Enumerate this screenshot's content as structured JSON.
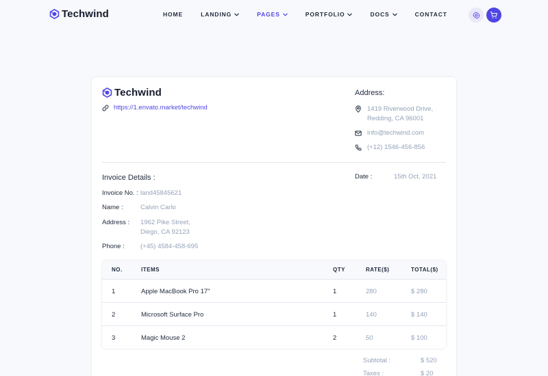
{
  "brand": {
    "name": "Techwind",
    "color": "#4f46e5"
  },
  "nav": {
    "items": [
      {
        "label": "HOME",
        "has_dropdown": false,
        "active": false
      },
      {
        "label": "LANDING",
        "has_dropdown": true,
        "active": false
      },
      {
        "label": "PAGES",
        "has_dropdown": true,
        "active": true
      },
      {
        "label": "PORTFOLIO",
        "has_dropdown": true,
        "active": false
      },
      {
        "label": "DOCS",
        "has_dropdown": true,
        "active": false
      },
      {
        "label": "CONTACT",
        "has_dropdown": false,
        "active": false
      }
    ],
    "icons": [
      "gear-icon",
      "cart-icon"
    ]
  },
  "invoice": {
    "company": "Techwind",
    "website": "https://1.envato.market/techwind",
    "address_title": "Address:",
    "address_line1": "1419 Riverwood Drive,",
    "address_line2": "Redding, CA 96001",
    "email": "info@techwind.com",
    "phone": "(+12) 1546-456-856",
    "details_title": "Invoice Details :",
    "date_label": "Date :",
    "date_value": "15th Oct, 2021",
    "fields": {
      "invoice_no_label": "Invoice No. :",
      "invoice_no_value": "land45845621",
      "name_label": "Name :",
      "name_value": "Calvin Carlo",
      "address_label": "Address :",
      "address_value_line1": "1962 Pike Street,",
      "address_value_line2": "Diego, CA 92123",
      "phone_label": "Phone :",
      "phone_value": "(+45) 4584-458-695"
    },
    "table": {
      "headers": {
        "no": "NO.",
        "items": "ITEMS",
        "qty": "QTY",
        "rate": "RATE($)",
        "total": "TOTAL($)"
      },
      "rows": [
        {
          "no": "1",
          "item": "Apple MacBook Pro 17\"",
          "qty": "1",
          "rate": "280",
          "total": "$ 280"
        },
        {
          "no": "2",
          "item": "Microsoft Surface Pro",
          "qty": "1",
          "rate": "140",
          "total": "$ 140"
        },
        {
          "no": "3",
          "item": "Magic Mouse 2",
          "qty": "2",
          "rate": "50",
          "total": "$ 100"
        }
      ]
    },
    "summary": {
      "subtotal_label": "Subtotal :",
      "subtotal_value": "$ 520",
      "taxes_label": "Taxes :",
      "taxes_value": "$ 20"
    }
  }
}
